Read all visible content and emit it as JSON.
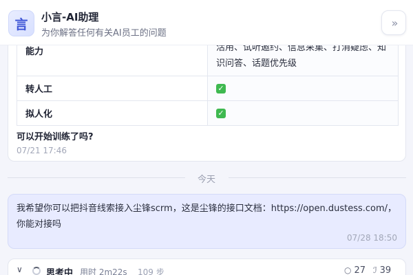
{
  "header": {
    "logo_glyph": "言",
    "title": "小言-AI助理",
    "subtitle": "为你解答任何有关AI员工的问题",
    "collapse_icon": "double-chevron-right-icon",
    "collapse_glyph": "»"
  },
  "capability_table": {
    "rows": [
      {
        "key": "能力",
        "value": "活用、试听邀约、信息采集、打消疑虑、知识问答、话题优先级"
      },
      {
        "key": "转人工",
        "value": "✓"
      },
      {
        "key": "拟人化",
        "value": "✓"
      }
    ]
  },
  "assistant_message": {
    "question": "可以开始训练了吗?",
    "time": "07/21 17:46"
  },
  "divider": {
    "label": "今天"
  },
  "user_message": {
    "text": "我希望你可以把抖音线索接入尘锋scrm，这是尘锋的接口文档：https://open.dustess.com/，你能对接吗",
    "time": "07/28 18:50"
  },
  "thinking": {
    "chevron_glyph": "∨",
    "label": "思考中",
    "duration": "用时 2m22s",
    "steps": "109 步",
    "stat1_icon": "bulb-icon",
    "stat1_glyph": "○",
    "stat1": "27",
    "stat2_icon": "tool-icon",
    "stat2_glyph": "ℐ",
    "stat2": "39"
  },
  "colors": {
    "accent": "#3f56d6",
    "user_bubble": "#e8ebff",
    "check_green": "#3fb950"
  }
}
